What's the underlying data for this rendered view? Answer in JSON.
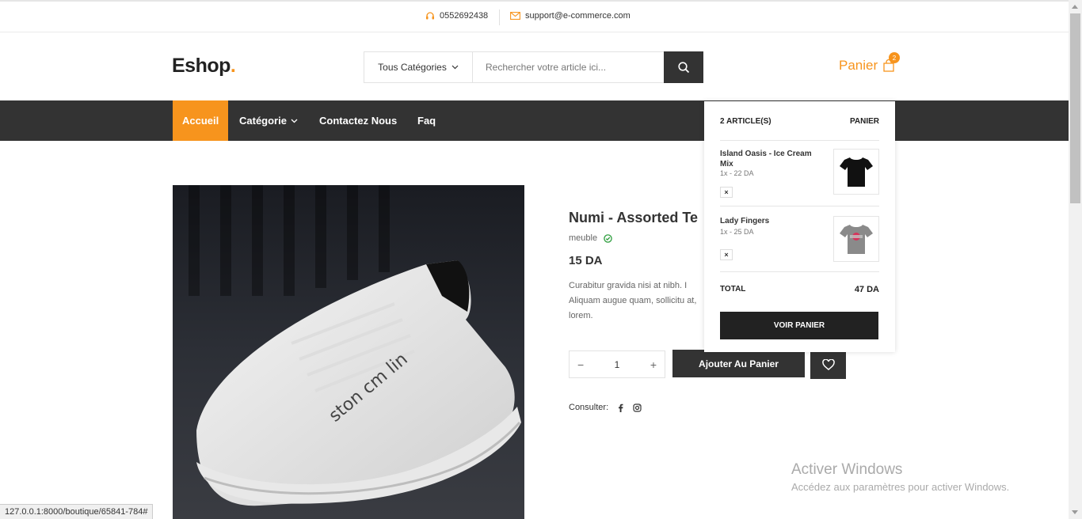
{
  "topbar": {
    "phone": "0552692438",
    "email": "support@e-commerce.com"
  },
  "header": {
    "logo": "Eshop",
    "logo_dot": ".",
    "search": {
      "category": "Tous Catégories",
      "placeholder": "Rechercher votre article ici..."
    },
    "cart": {
      "label": "Panier",
      "count": "2"
    }
  },
  "nav": {
    "items": [
      {
        "label": "Accueil"
      },
      {
        "label": "Catégorie"
      },
      {
        "label": "Contactez Nous"
      },
      {
        "label": "Faq"
      }
    ]
  },
  "product": {
    "title": "Numi - Assorted Te",
    "category": "meuble",
    "price": "15 DA",
    "description": "Curabitur gravida nisi at nibh. I Aliquam augue quam, sollicitu at, lorem.",
    "quantity": "1",
    "add_to_cart": "Ajouter Au Panier",
    "share_label": "Consulter:",
    "image_text": "ston cm lin"
  },
  "cart_dropdown": {
    "count_label": "2 ARTICLE(S)",
    "cart_link": "PANIER",
    "items": [
      {
        "name": "Island Oasis - Ice Cream Mix",
        "qty": "1x - 22 DA",
        "remove": "×"
      },
      {
        "name": "Lady Fingers",
        "qty": "1x - 25 DA",
        "remove": "×"
      }
    ],
    "total_label": "TOTAL",
    "total_value": "47 DA",
    "view_cart": "VOIR PANIER"
  },
  "watermark": {
    "title": "Activer Windows",
    "subtitle": "Accédez aux paramètres pour activer Windows."
  },
  "status_url": "127.0.0.1:8000/boutique/65841-784#",
  "colors": {
    "accent": "#f7941d",
    "dark": "#333333"
  }
}
